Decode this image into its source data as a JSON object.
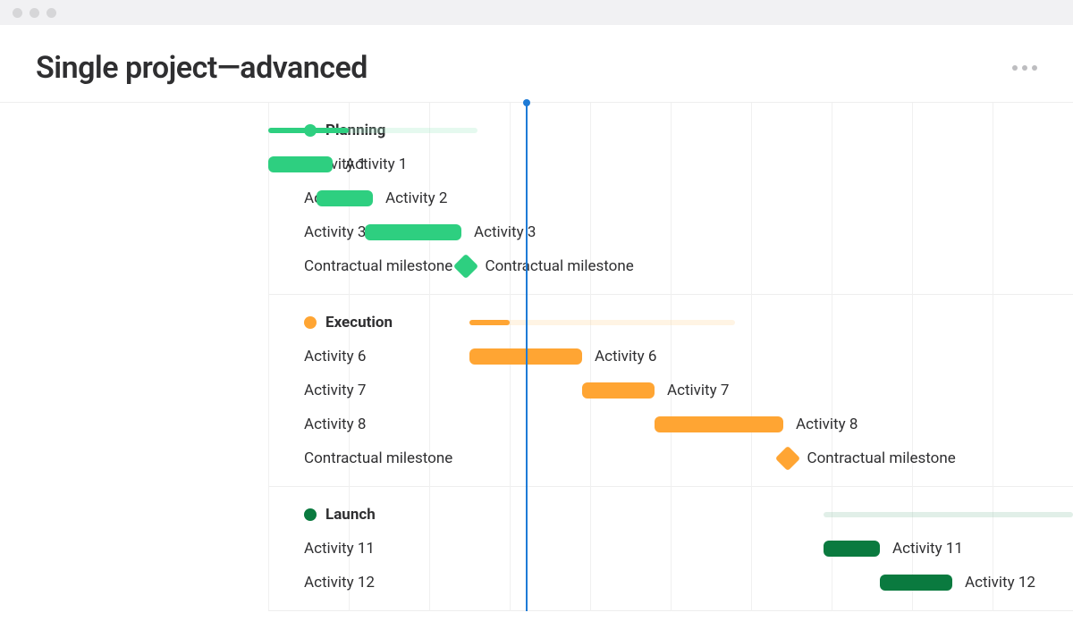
{
  "page_title": "Single project—advanced",
  "today_pct": 32.0,
  "grid_lines_pct": [
    0,
    10,
    20,
    30,
    40,
    50,
    60,
    70,
    80,
    90
  ],
  "colors": {
    "planning": "#2ecf80",
    "execution": "#ffa533",
    "launch": "#0a7a3f"
  },
  "groups": [
    {
      "id": "planning",
      "label": "Planning",
      "color_class": "c-green-light",
      "pale_class": "c-green-light-pale",
      "summary": {
        "start_pct": 0,
        "end_pct": 26,
        "progress_end_pct": 10
      },
      "rows": [
        {
          "type": "task",
          "label": "Activity 1",
          "start_pct": 0,
          "end_pct": 8
        },
        {
          "type": "task",
          "label": "Activity 2",
          "start_pct": 6,
          "end_pct": 13
        },
        {
          "type": "task",
          "label": "Activity 3",
          "start_pct": 12,
          "end_pct": 24
        },
        {
          "type": "milestone",
          "label": "Contractual milestone",
          "at_pct": 24.5
        }
      ]
    },
    {
      "id": "execution",
      "label": "Execution",
      "color_class": "c-orange",
      "pale_class": "c-orange-pale",
      "summary": {
        "start_pct": 25,
        "end_pct": 58,
        "progress_end_pct": 30
      },
      "rows": [
        {
          "type": "task",
          "label": "Activity 6",
          "start_pct": 25,
          "end_pct": 39
        },
        {
          "type": "task",
          "label": "Activity 7",
          "start_pct": 39,
          "end_pct": 48
        },
        {
          "type": "task",
          "label": "Activity 8",
          "start_pct": 48,
          "end_pct": 64
        },
        {
          "type": "milestone",
          "label": "Contractual milestone",
          "at_pct": 64.5
        }
      ]
    },
    {
      "id": "launch",
      "label": "Launch",
      "color_class": "c-green-dark",
      "pale_class": "c-green-dark-pale",
      "summary": {
        "start_pct": 69,
        "end_pct": 100,
        "progress_end_pct": 69
      },
      "rows": [
        {
          "type": "task",
          "label": "Activity 11",
          "start_pct": 69,
          "end_pct": 76
        },
        {
          "type": "task",
          "label": "Activity 12",
          "start_pct": 76,
          "end_pct": 85
        }
      ]
    }
  ],
  "chart_data": {
    "type": "bar",
    "title": "Single project—advanced",
    "xlabel": "",
    "ylabel": "",
    "today": 32,
    "series": [
      {
        "name": "Planning summary",
        "group": "Planning",
        "kind": "summary",
        "start": 0,
        "end": 26,
        "progress_end": 10
      },
      {
        "name": "Activity 1",
        "group": "Planning",
        "kind": "task",
        "start": 0,
        "end": 8
      },
      {
        "name": "Activity 2",
        "group": "Planning",
        "kind": "task",
        "start": 6,
        "end": 13
      },
      {
        "name": "Activity 3",
        "group": "Planning",
        "kind": "task",
        "start": 12,
        "end": 24
      },
      {
        "name": "Contractual milestone",
        "group": "Planning",
        "kind": "milestone",
        "at": 24.5
      },
      {
        "name": "Execution summary",
        "group": "Execution",
        "kind": "summary",
        "start": 25,
        "end": 58,
        "progress_end": 30
      },
      {
        "name": "Activity 6",
        "group": "Execution",
        "kind": "task",
        "start": 25,
        "end": 39
      },
      {
        "name": "Activity 7",
        "group": "Execution",
        "kind": "task",
        "start": 39,
        "end": 48
      },
      {
        "name": "Activity 8",
        "group": "Execution",
        "kind": "task",
        "start": 48,
        "end": 64
      },
      {
        "name": "Contractual milestone",
        "group": "Execution",
        "kind": "milestone",
        "at": 64.5
      },
      {
        "name": "Launch summary",
        "group": "Launch",
        "kind": "summary",
        "start": 69,
        "end": 100,
        "progress_end": 69
      },
      {
        "name": "Activity 11",
        "group": "Launch",
        "kind": "task",
        "start": 69,
        "end": 76
      },
      {
        "name": "Activity 12",
        "group": "Launch",
        "kind": "task",
        "start": 76,
        "end": 85
      }
    ]
  }
}
